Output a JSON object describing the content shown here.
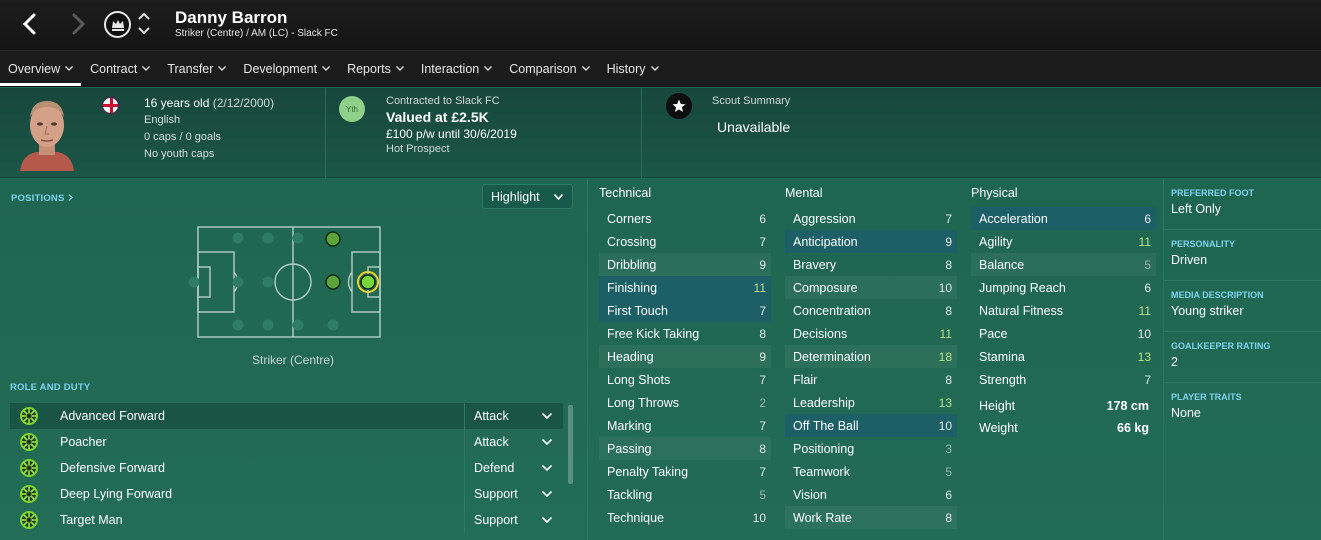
{
  "header": {
    "player_name": "Danny Barron",
    "player_sub": "Striker (Centre) / AM (LC) - Slack FC"
  },
  "menu": [
    {
      "label": "Overview"
    },
    {
      "label": "Contract"
    },
    {
      "label": "Transfer"
    },
    {
      "label": "Development"
    },
    {
      "label": "Reports"
    },
    {
      "label": "Interaction"
    },
    {
      "label": "Comparison"
    },
    {
      "label": "History"
    }
  ],
  "info": {
    "age": "16 years old",
    "dob": "(2/12/2000)",
    "nationality": "English",
    "caps": "0 caps / 0 goals",
    "youth_caps": "No youth caps",
    "yth_badge": "Yth",
    "contract_label": "Contracted to Slack FC",
    "value": "Valued at £2.5K",
    "wage": "£100 p/w until 30/6/2019",
    "status": "Hot Prospect",
    "scout_label": "Scout Summary",
    "scout_value": "Unavailable"
  },
  "positions": {
    "header": "POSITIONS",
    "highlight_label": "Highlight",
    "position_label": "Striker (Centre)"
  },
  "roles": {
    "header": "ROLE AND DUTY",
    "items": [
      {
        "name": "Advanced Forward",
        "duty": "Attack"
      },
      {
        "name": "Poacher",
        "duty": "Attack"
      },
      {
        "name": "Defensive Forward",
        "duty": "Defend"
      },
      {
        "name": "Deep Lying Forward",
        "duty": "Support"
      },
      {
        "name": "Target Man",
        "duty": "Support"
      }
    ]
  },
  "attributes": {
    "technical": {
      "title": "Technical",
      "items": [
        {
          "name": "Corners",
          "value": "6"
        },
        {
          "name": "Crossing",
          "value": "7"
        },
        {
          "name": "Dribbling",
          "value": "9"
        },
        {
          "name": "Finishing",
          "value": "11"
        },
        {
          "name": "First Touch",
          "value": "7"
        },
        {
          "name": "Free Kick Taking",
          "value": "8"
        },
        {
          "name": "Heading",
          "value": "9"
        },
        {
          "name": "Long Shots",
          "value": "7"
        },
        {
          "name": "Long Throws",
          "value": "2"
        },
        {
          "name": "Marking",
          "value": "7"
        },
        {
          "name": "Passing",
          "value": "8"
        },
        {
          "name": "Penalty Taking",
          "value": "7"
        },
        {
          "name": "Tackling",
          "value": "5"
        },
        {
          "name": "Technique",
          "value": "10"
        }
      ]
    },
    "mental": {
      "title": "Mental",
      "items": [
        {
          "name": "Aggression",
          "value": "7"
        },
        {
          "name": "Anticipation",
          "value": "9"
        },
        {
          "name": "Bravery",
          "value": "8"
        },
        {
          "name": "Composure",
          "value": "10"
        },
        {
          "name": "Concentration",
          "value": "8"
        },
        {
          "name": "Decisions",
          "value": "11"
        },
        {
          "name": "Determination",
          "value": "18"
        },
        {
          "name": "Flair",
          "value": "8"
        },
        {
          "name": "Leadership",
          "value": "13"
        },
        {
          "name": "Off The Ball",
          "value": "10"
        },
        {
          "name": "Positioning",
          "value": "3"
        },
        {
          "name": "Teamwork",
          "value": "5"
        },
        {
          "name": "Vision",
          "value": "6"
        },
        {
          "name": "Work Rate",
          "value": "8"
        }
      ]
    },
    "physical": {
      "title": "Physical",
      "items": [
        {
          "name": "Acceleration",
          "value": "6"
        },
        {
          "name": "Agility",
          "value": "11"
        },
        {
          "name": "Balance",
          "value": "5"
        },
        {
          "name": "Jumping Reach",
          "value": "6"
        },
        {
          "name": "Natural Fitness",
          "value": "11"
        },
        {
          "name": "Pace",
          "value": "10"
        },
        {
          "name": "Stamina",
          "value": "13"
        },
        {
          "name": "Strength",
          "value": "7"
        }
      ],
      "height_label": "Height",
      "height_value": "178 cm",
      "weight_label": "Weight",
      "weight_value": "66 kg"
    }
  },
  "side": {
    "items": [
      {
        "label": "PREFERRED FOOT",
        "value": "Left Only"
      },
      {
        "label": "PERSONALITY",
        "value": "Driven"
      },
      {
        "label": "MEDIA DESCRIPTION",
        "value": "Young striker"
      },
      {
        "label": "GOALKEEPER RATING",
        "value": "2"
      },
      {
        "label": "PLAYER TRAITS",
        "value": "None"
      }
    ]
  },
  "colors": {
    "accent_label": "#7fd3f2",
    "good_value": "#b8e28a",
    "highlight_row": "#1c5c6e"
  }
}
